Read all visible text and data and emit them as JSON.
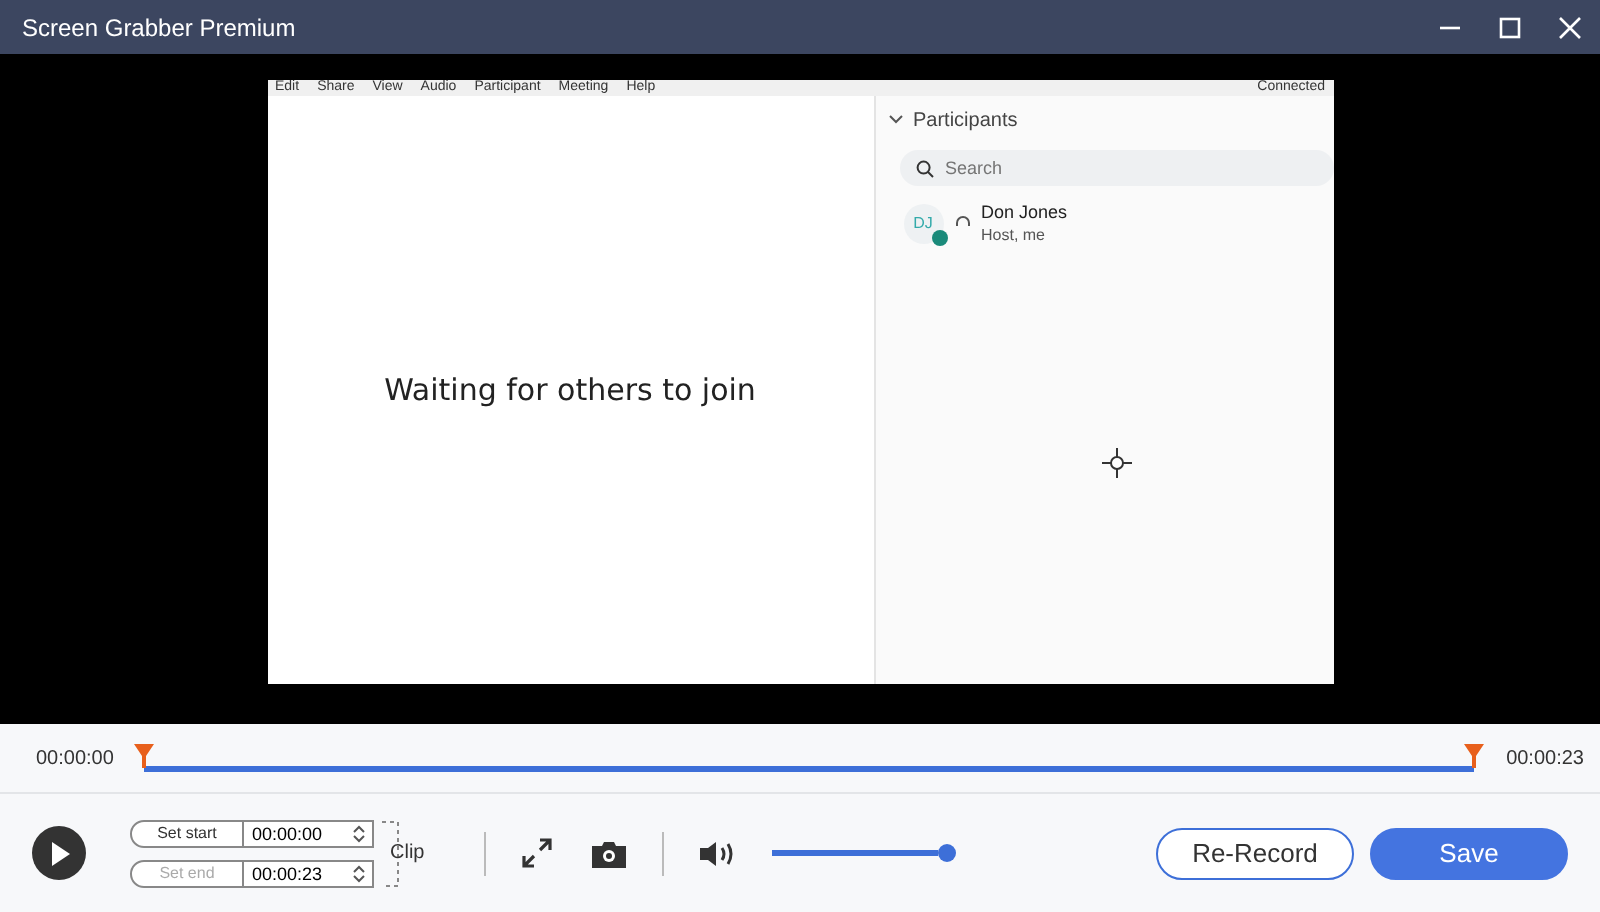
{
  "window": {
    "title": "Screen Grabber Premium"
  },
  "recording": {
    "menu": [
      "Edit",
      "Share",
      "View",
      "Audio",
      "Participant",
      "Meeting",
      "Help"
    ],
    "status": "Connected",
    "message": "Waiting for others to join",
    "participants": {
      "title": "Participants",
      "expanded": true,
      "search": {
        "placeholder": "Search"
      },
      "people": [
        {
          "initials": "DJ",
          "name": "Don Jones",
          "role": "Host, me"
        }
      ]
    }
  },
  "timeline": {
    "start": "00:00:00",
    "end": "00:00:23",
    "trim_start": {
      "level": 0
    },
    "trim_end": {
      "level": 1
    }
  },
  "clip": {
    "label": "Clip",
    "rows": [
      {
        "label": "Set start",
        "value": "00:00:00",
        "disabled": false
      },
      {
        "label": "Set end",
        "value": "00:00:23",
        "disabled": true
      }
    ]
  },
  "volume": {
    "level": 1
  },
  "buttons": [
    {
      "label": "Re-Record",
      "kind": "outline"
    },
    {
      "label": "Save",
      "kind": "primary"
    }
  ]
}
